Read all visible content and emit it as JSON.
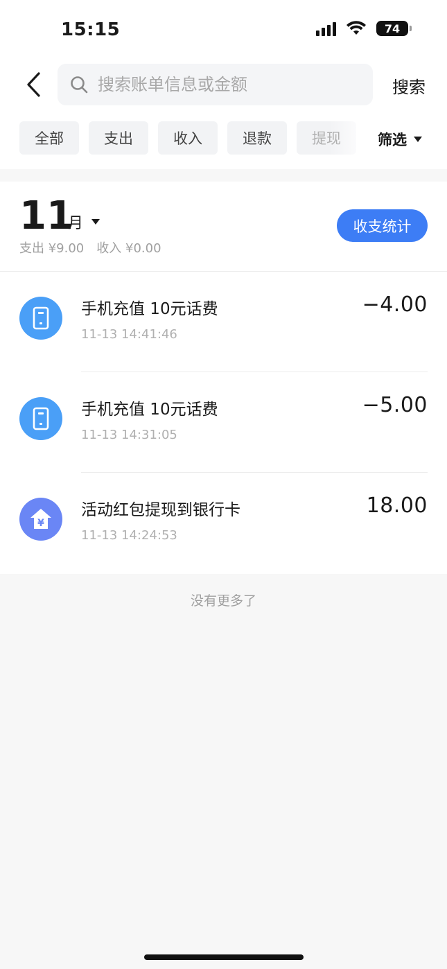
{
  "status_bar": {
    "time": "15:15",
    "battery": "74",
    "signal_icon": "cellular-signal-icon",
    "wifi_icon": "wifi-icon"
  },
  "search": {
    "placeholder": "搜索账单信息或金额",
    "value": "",
    "button_label": "搜索"
  },
  "filter_tabs": [
    {
      "label": "全部"
    },
    {
      "label": "支出"
    },
    {
      "label": "收入"
    },
    {
      "label": "退款"
    },
    {
      "label": "提现"
    }
  ],
  "filter_button": {
    "label": "筛选"
  },
  "month_header": {
    "month": "11",
    "unit": "月",
    "expense_label": "支出 ¥9.00",
    "income_label": "收入 ¥0.00",
    "stats_button": "收支统计"
  },
  "transactions": [
    {
      "title": "手机充值 10元话费",
      "time": "11-13 14:41:46",
      "amount": "−4.00",
      "icon": "phone-recharge-icon",
      "icon_color": "#4a9ff7"
    },
    {
      "title": "手机充值 10元话费",
      "time": "11-13 14:31:05",
      "amount": "−5.00",
      "icon": "phone-recharge-icon",
      "icon_color": "#4a9ff7"
    },
    {
      "title": "活动红包提现到银行卡",
      "time": "11-13 14:24:53",
      "amount": "18.00",
      "icon": "withdraw-yuan-icon",
      "icon_color": "#6a86f5"
    }
  ],
  "footer": {
    "no_more": "没有更多了"
  },
  "colors": {
    "accent": "#3d7df5",
    "background": "#f7f7f7"
  }
}
